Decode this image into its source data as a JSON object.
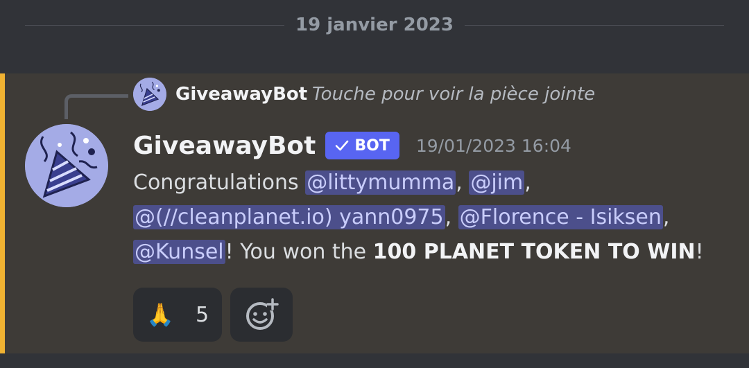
{
  "divider": {
    "date": "19 janvier 2023"
  },
  "reply": {
    "author": "GiveawayBot",
    "content": "Touche pour voir la pièce jointe"
  },
  "message": {
    "author": "GiveawayBot",
    "bot_tag": "BOT",
    "timestamp": "19/01/2023 16:04",
    "content": {
      "intro": "Congratulations ",
      "mentions": [
        "@littymumma",
        "@jim",
        "@(//cleanplanet.io) yann0975",
        "@Florence - Isiksen",
        "@Kunsel"
      ],
      "sep": ", ",
      "won_text": "! You won the ",
      "prize": "100 PLANET TOKEN TO WIN",
      "end": "!"
    }
  },
  "reactions": [
    {
      "emoji": "🙏",
      "count": "5"
    }
  ],
  "colors": {
    "accent": "#f0b232",
    "bot_tag": "#5865f2",
    "mention_bg": "#4c4f8b",
    "avatar_bg": "#a4abe6"
  },
  "icons": {
    "avatar": "party-popper-icon",
    "bot_check": "checkmark-icon",
    "add_reaction": "add-reaction-icon"
  }
}
